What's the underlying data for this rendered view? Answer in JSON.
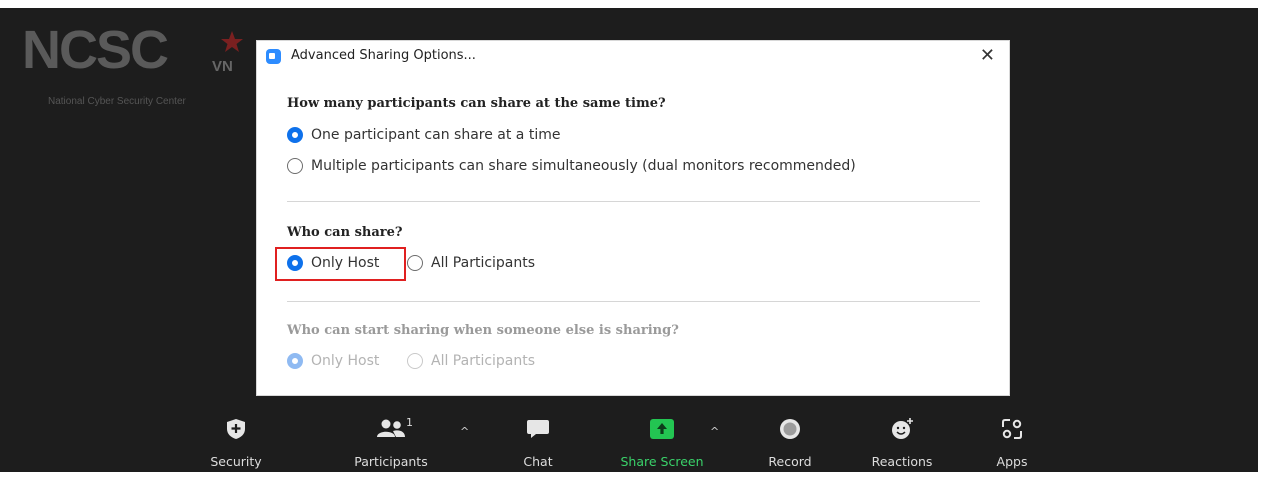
{
  "watermark": {
    "logo_text": "NCSC",
    "logo_suffix": "VN",
    "organization": "National Cyber Security Center"
  },
  "dialog": {
    "title": "Advanced Sharing Options...",
    "close_glyph": "✕",
    "q1": {
      "question": "How many participants can share at the same time?",
      "options": [
        {
          "label": "One participant can share at a time",
          "selected": true
        },
        {
          "label": "Multiple participants can share simultaneously (dual monitors recommended)",
          "selected": false
        }
      ]
    },
    "q2": {
      "question": "Who can share?",
      "options": [
        {
          "label": "Only Host",
          "selected": true
        },
        {
          "label": "All Participants",
          "selected": false
        }
      ]
    },
    "q3": {
      "question": "Who can start sharing when someone else is sharing?",
      "disabled": true,
      "options": [
        {
          "label": "Only Host",
          "selected": true
        },
        {
          "label": "All Participants",
          "selected": false
        }
      ]
    }
  },
  "toolbar": {
    "security": "Security",
    "participants": "Participants",
    "participants_count": "1",
    "chat": "Chat",
    "share_screen": "Share Screen",
    "record": "Record",
    "reactions": "Reactions",
    "apps": "Apps",
    "caret_glyph": "^"
  },
  "colors": {
    "accent": "#0e71eb",
    "share_green": "#23c552",
    "highlight": "#e02020",
    "background": "#1d1d1d"
  }
}
